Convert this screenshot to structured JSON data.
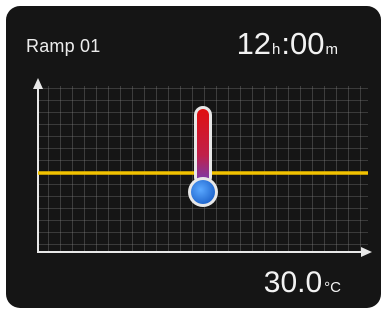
{
  "display": {
    "ramp_label": "Ramp 01",
    "time": {
      "hours": "12",
      "hours_unit": "h",
      "separator": ":",
      "minutes": "00",
      "minutes_unit": "m"
    },
    "temperature": {
      "value": "30.0",
      "unit": "°C"
    },
    "icons": {
      "thermometer": "thermometer-icon"
    },
    "colors": {
      "background": "#151515",
      "grid": "#8a8a8a",
      "setpoint_line": "#f2c200",
      "thermometer_top": "#e01010",
      "thermometer_bottom": "#2a7de0"
    }
  }
}
